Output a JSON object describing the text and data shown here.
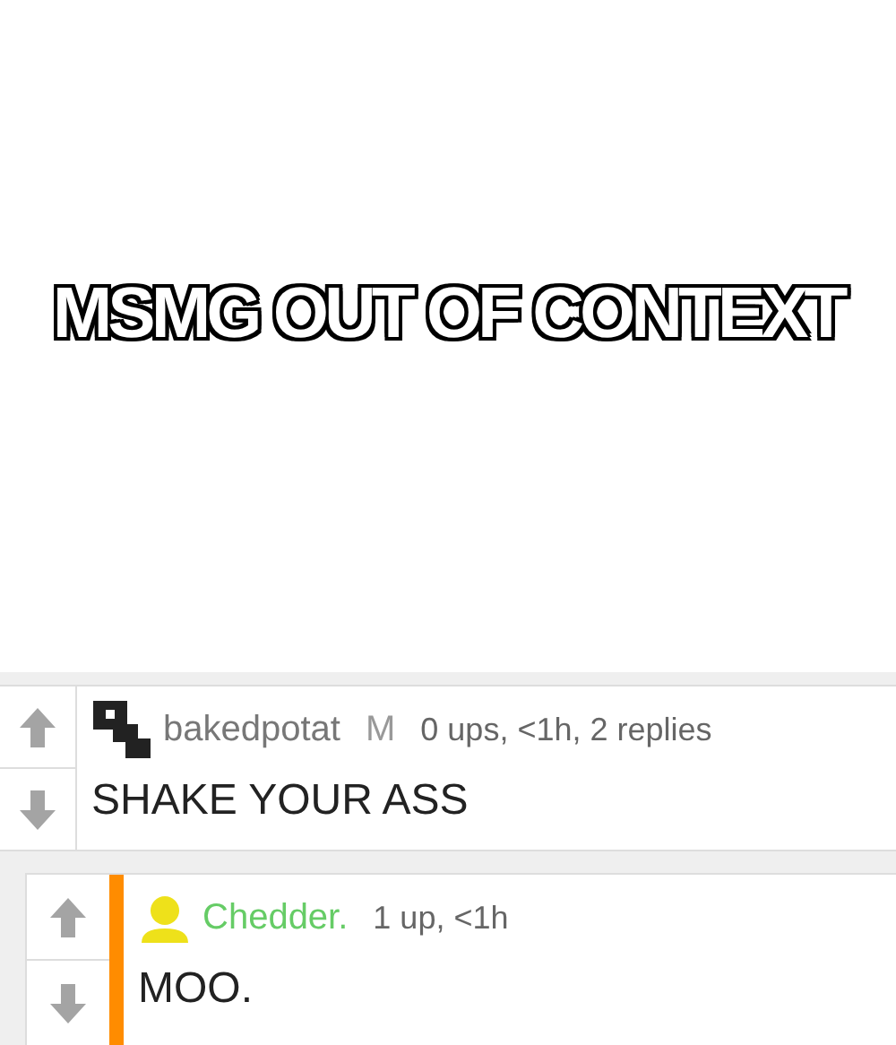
{
  "caption": "MSMG OUT OF CONTEXT",
  "comments": [
    {
      "avatar": {
        "kind": "pattern"
      },
      "username": "bakedpotat",
      "color": "#777777",
      "badge": "M",
      "meta": "0 ups, <1h, 2 replies",
      "text": "SHAKE YOUR ASS",
      "reply": false,
      "highlighted": false
    },
    {
      "avatar": {
        "kind": "person"
      },
      "username": "Chedder.",
      "color": "#66cc66",
      "meta": "1 up, <1h",
      "text": "MOO.",
      "reply": true,
      "highlighted": true
    }
  ]
}
